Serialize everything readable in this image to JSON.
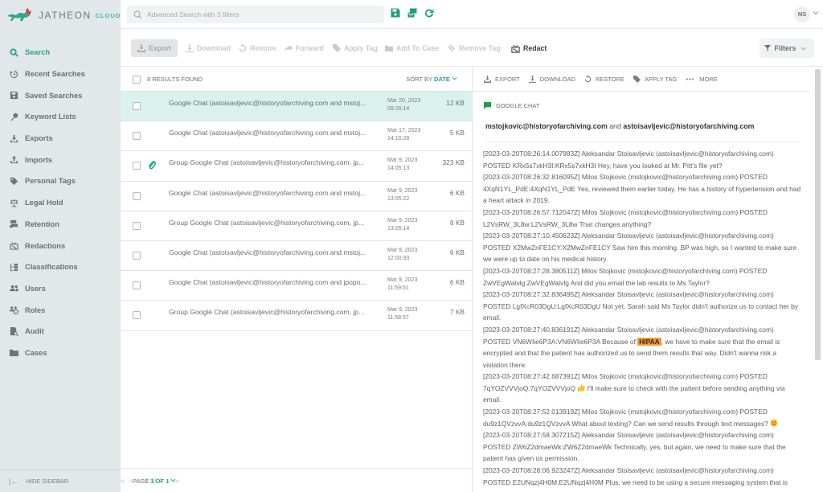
{
  "app": {
    "brand_main": "JATHEON",
    "brand_sub": "CLOUD"
  },
  "sidebar": {
    "items": [
      {
        "label": "Search",
        "icon": "search-icon",
        "active": true
      },
      {
        "label": "Recent Searches",
        "icon": "history-icon"
      },
      {
        "label": "Saved Searches",
        "icon": "save-icon"
      },
      {
        "label": "Keyword Lists",
        "icon": "key-icon"
      },
      {
        "label": "Exports",
        "icon": "export-icon"
      },
      {
        "label": "Imports",
        "icon": "import-icon"
      },
      {
        "label": "Personal Tags",
        "icon": "tag-icon"
      },
      {
        "label": "Legal Hold",
        "icon": "scale-icon"
      },
      {
        "label": "Retention",
        "icon": "retention-icon"
      },
      {
        "label": "Redactions",
        "icon": "redact-icon"
      },
      {
        "label": "Classifications",
        "icon": "classification-icon"
      },
      {
        "label": "Users",
        "icon": "users-icon"
      },
      {
        "label": "Roles",
        "icon": "roles-icon"
      },
      {
        "label": "Audit",
        "icon": "audit-icon"
      },
      {
        "label": "Cases",
        "icon": "folder-icon"
      }
    ],
    "hide_label": "HIDE SIDEBAR"
  },
  "topbar": {
    "search_placeholder": "Advanced Search with 3 filters",
    "user_initials": "MS"
  },
  "actionbar": {
    "export": "Export",
    "download": "Download",
    "restore": "Restore",
    "forward": "Forward",
    "apply_tag": "Apply Tag",
    "add_to_case": "Add To Case",
    "remove_tag": "Remove Tag",
    "redact": "Redact",
    "filters": "Filters"
  },
  "results": {
    "count_label": "8 RESULTS FOUND",
    "sort_prefix": "SORT BY",
    "sort_field": "DATE",
    "rows": [
      {
        "title": "Google Chat (astoisavljevic@historyofarchiving.com and mstoj...",
        "date": "Mar 20, 2023",
        "time": "09:26:14",
        "size": "12 KB",
        "selected": true,
        "attachment": false
      },
      {
        "title": "Google Chat (astoisavljevic@historyofarchiving.com and mstoj...",
        "date": "Mar 17, 2023",
        "time": "14:10:28",
        "size": "5 KB",
        "selected": false,
        "attachment": false
      },
      {
        "title": "Group Google Chat (astoisavljevic@historyofarchiving.com, jp...",
        "date": "Mar 9, 2023",
        "time": "14:05:13",
        "size": "323 KB",
        "selected": false,
        "attachment": true
      },
      {
        "title": "Google Chat (astoisavljevic@historyofarchiving.com and mstoj...",
        "date": "Mar 9, 2023",
        "time": "13:05:22",
        "size": "6 KB",
        "selected": false,
        "attachment": false
      },
      {
        "title": "Group Google Chat (astoisavljevic@historyofarchiving.com, jp...",
        "date": "Mar 9, 2023",
        "time": "13:05:14",
        "size": "8 KB",
        "selected": false,
        "attachment": false
      },
      {
        "title": "Google Chat (astoisavljevic@historyofarchiving.com and mstoj...",
        "date": "Mar 9, 2023",
        "time": "12:00:33",
        "size": "6 KB",
        "selected": false,
        "attachment": false
      },
      {
        "title": "Google Chat (astoisavljevic@historyofarchiving.com and jpopo...",
        "date": "Mar 9, 2023",
        "time": "11:59:51",
        "size": "6 KB",
        "selected": false,
        "attachment": false
      },
      {
        "title": "Group Google Chat (astoisavljevic@historyofarchiving.com, jp...",
        "date": "Mar 9, 2023",
        "time": "11:58:57",
        "size": "7 KB",
        "selected": false,
        "attachment": false
      }
    ],
    "page_prefix": "PAGE",
    "page_value": "1 OF 1",
    "range": "1 - 8 OF 8"
  },
  "preview": {
    "actions": {
      "export": "EXPORT",
      "download": "DOWNLOAD",
      "restore": "RESTORE",
      "apply_tag": "APPLY TAG",
      "more": "MORE"
    },
    "source": "GOOGLE CHAT",
    "participant_a": "mstojkovic@historyofarchiving.com",
    "participants_joiner": "and",
    "participant_b": "astoisavljevic@historyofarchiving.com",
    "highlight_term": "HIPAA",
    "messages": [
      {
        "text": "[2023-03-20T08:26:14.007983Z] Aleksandar Stoisavljevic (astoisavljevic@historyofarchiving.com) POSTED KRx5s7xkH3I:KRx5s7xkH3I Hey, have you looked at Mr. Pitt's file yet?"
      },
      {
        "text": "[2023-03-20T08:26:32.816095Z] Milos Stojkovic (mstojkovic@historyofarchiving.com) POSTED 4XqN1YL_PdE:4XqN1YL_PdE Yes, reviewed them earlier today. He has a history of hypertension and had a heart attack in 2019."
      },
      {
        "text": "[2023-03-20T08:26:57.712047Z] Milos Stojkovic (mstojkovic@historyofarchiving.com) POSTED L2VsRW_3L8w:L2VsRW_3L8w That changes anything?"
      },
      {
        "text": "[2023-03-20T08:27:10.450623Z] Aleksandar Stoisavljevic (astoisavljevic@historyofarchiving.com) POSTED X2MwZnFE1CY:X2MwZnFE1CY Saw him this morning. BP was high, so I wanted to make sure we were up to date on his medical history."
      },
      {
        "text": "[2023-03-20T08:27:28.380511Z] Milos Stojkovic (mstojkovic@historyofarchiving.com) POSTED ZwVEgWatvlg:ZwVEgWatvlg And did you email the lab results to Ms Taylor?"
      },
      {
        "text": "[2023-03-20T08:27:32.836495Z] Aleksandar Stoisavljevic (astoisavljevic@historyofarchiving.com) POSTED LgfXcR03DgU:LgfXcR03DgU Not yet. Sarah said Ms Taylor didn't authorize us to contact her by email."
      },
      {
        "pre": "[2023-03-20T08:27:40.836191Z] Aleksandar Stoisavljevic (astoisavljevic@historyofarchiving.com) POSTED VN6WIie6P3A:VN6WIie6P3A Because of ",
        "post": ", we have to make sure that the email is encrypted and that the patient has authorized us to send them results that way. Didn't wanna risk a violation there."
      },
      {
        "pre": "[2023-03-20T08:27:42.687391Z] Milos Stojkovic (mstojkovic@historyofarchiving.com) POSTED 7qYOZVVVjoQ:7qYOZVVVjoQ ",
        "emoji": "thumbs-up",
        "post": " I'll make sure to check with the patient before sending anything via email."
      },
      {
        "pre": "[2023-03-20T08:27:52.013919Z] Milos Stojkovic (mstojkovic@historyofarchiving.com) POSTED du9z1QVzvvA:du9z1QVzvvA What about texting? Can we send results through text messages? ",
        "emoji": "thinking-face",
        "post": ""
      },
      {
        "text": "[2023-03-20T08:27:58.307215Z] Aleksandar Stoisavljevic (astoisavljevic@historyofarchiving.com) POSTED ZW6Z2dmaeWk:ZW6Z2dmaeWk Technically, yes, but again, we need to make sure that the patient has given us permission."
      },
      {
        "text": "[2023-03-20T08:28:06.923247Z] Aleksandar Stoisavljevic (astoisavljevic@historyofarchiving.com) POSTED E2UNqzj4H0M:E2UNqzj4H0M Plus, we need to be using a secure messaging system that is"
      }
    ]
  },
  "colors": {
    "accent": "#22a886",
    "selected_row": "#d9f2ed",
    "highlight": "#f29a3c",
    "sidebar_bg": "#e2e7ea"
  }
}
